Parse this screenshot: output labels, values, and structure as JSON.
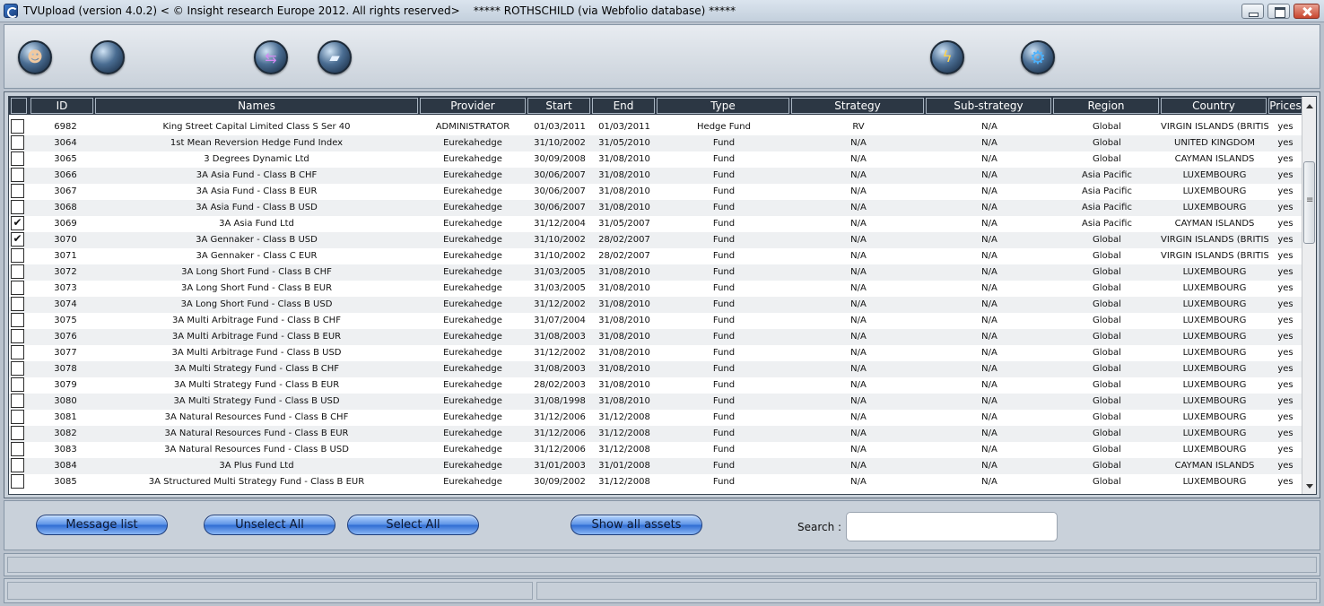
{
  "window": {
    "title": "TVUpload (version 4.0.2) < © Insight research Europe 2012. All rights reserved>    ***** ROTHSCHILD (via Webfolio database) *****"
  },
  "toolbar": {
    "icons": [
      "user-icon",
      "grid-icon",
      "sync-icon",
      "book-icon",
      "bolt-icon",
      "gear-icon"
    ]
  },
  "table": {
    "headers": {
      "id": "ID",
      "names": "Names",
      "provider": "Provider",
      "start": "Start",
      "end": "End",
      "type": "Type",
      "strategy": "Strategy",
      "substrategy": "Sub-strategy",
      "region": "Region",
      "country": "Country",
      "prices": "Prices"
    },
    "rows": [
      {
        "checked": false,
        "id": "6982",
        "name": "King Street Capital Limited Class S  Ser 40",
        "provider": "ADMINISTRATOR",
        "start": "01/03/2011",
        "end": "01/03/2011",
        "type": "Hedge Fund",
        "strategy": "RV",
        "substrategy": "N/A",
        "region": "Global",
        "country": "VIRGIN ISLANDS (BRITISH)",
        "prices": "yes"
      },
      {
        "checked": false,
        "id": "3064",
        "name": "1st Mean Reversion Hedge Fund Index",
        "provider": "Eurekahedge",
        "start": "31/10/2002",
        "end": "31/05/2010",
        "type": "Fund",
        "strategy": "N/A",
        "substrategy": "N/A",
        "region": "Global",
        "country": "UNITED KINGDOM",
        "prices": "yes"
      },
      {
        "checked": false,
        "id": "3065",
        "name": "3 Degrees Dynamic Ltd",
        "provider": "Eurekahedge",
        "start": "30/09/2008",
        "end": "31/08/2010",
        "type": "Fund",
        "strategy": "N/A",
        "substrategy": "N/A",
        "region": "Global",
        "country": "CAYMAN ISLANDS",
        "prices": "yes"
      },
      {
        "checked": false,
        "id": "3066",
        "name": "3A Asia Fund - Class B CHF",
        "provider": "Eurekahedge",
        "start": "30/06/2007",
        "end": "31/08/2010",
        "type": "Fund",
        "strategy": "N/A",
        "substrategy": "N/A",
        "region": "Asia Pacific",
        "country": "LUXEMBOURG",
        "prices": "yes"
      },
      {
        "checked": false,
        "id": "3067",
        "name": "3A Asia Fund - Class B EUR",
        "provider": "Eurekahedge",
        "start": "30/06/2007",
        "end": "31/08/2010",
        "type": "Fund",
        "strategy": "N/A",
        "substrategy": "N/A",
        "region": "Asia Pacific",
        "country": "LUXEMBOURG",
        "prices": "yes"
      },
      {
        "checked": false,
        "id": "3068",
        "name": "3A Asia Fund - Class B USD",
        "provider": "Eurekahedge",
        "start": "30/06/2007",
        "end": "31/08/2010",
        "type": "Fund",
        "strategy": "N/A",
        "substrategy": "N/A",
        "region": "Asia Pacific",
        "country": "LUXEMBOURG",
        "prices": "yes"
      },
      {
        "checked": true,
        "id": "3069",
        "name": "3A Asia Fund Ltd",
        "provider": "Eurekahedge",
        "start": "31/12/2004",
        "end": "31/05/2007",
        "type": "Fund",
        "strategy": "N/A",
        "substrategy": "N/A",
        "region": "Asia Pacific",
        "country": "CAYMAN ISLANDS",
        "prices": "yes"
      },
      {
        "checked": true,
        "id": "3070",
        "name": "3A Gennaker - Class B USD",
        "provider": "Eurekahedge",
        "start": "31/10/2002",
        "end": "28/02/2007",
        "type": "Fund",
        "strategy": "N/A",
        "substrategy": "N/A",
        "region": "Global",
        "country": "VIRGIN ISLANDS (BRITISH)",
        "prices": "yes"
      },
      {
        "checked": false,
        "id": "3071",
        "name": "3A Gennaker - Class C EUR",
        "provider": "Eurekahedge",
        "start": "31/10/2002",
        "end": "28/02/2007",
        "type": "Fund",
        "strategy": "N/A",
        "substrategy": "N/A",
        "region": "Global",
        "country": "VIRGIN ISLANDS (BRITISH)",
        "prices": "yes"
      },
      {
        "checked": false,
        "id": "3072",
        "name": "3A Long Short Fund - Class B CHF",
        "provider": "Eurekahedge",
        "start": "31/03/2005",
        "end": "31/08/2010",
        "type": "Fund",
        "strategy": "N/A",
        "substrategy": "N/A",
        "region": "Global",
        "country": "LUXEMBOURG",
        "prices": "yes"
      },
      {
        "checked": false,
        "id": "3073",
        "name": "3A Long Short Fund - Class B EUR",
        "provider": "Eurekahedge",
        "start": "31/03/2005",
        "end": "31/08/2010",
        "type": "Fund",
        "strategy": "N/A",
        "substrategy": "N/A",
        "region": "Global",
        "country": "LUXEMBOURG",
        "prices": "yes"
      },
      {
        "checked": false,
        "id": "3074",
        "name": "3A Long Short Fund - Class B USD",
        "provider": "Eurekahedge",
        "start": "31/12/2002",
        "end": "31/08/2010",
        "type": "Fund",
        "strategy": "N/A",
        "substrategy": "N/A",
        "region": "Global",
        "country": "LUXEMBOURG",
        "prices": "yes"
      },
      {
        "checked": false,
        "id": "3075",
        "name": "3A Multi Arbitrage Fund - Class B CHF",
        "provider": "Eurekahedge",
        "start": "31/07/2004",
        "end": "31/08/2010",
        "type": "Fund",
        "strategy": "N/A",
        "substrategy": "N/A",
        "region": "Global",
        "country": "LUXEMBOURG",
        "prices": "yes"
      },
      {
        "checked": false,
        "id": "3076",
        "name": "3A Multi Arbitrage Fund - Class B EUR",
        "provider": "Eurekahedge",
        "start": "31/08/2003",
        "end": "31/08/2010",
        "type": "Fund",
        "strategy": "N/A",
        "substrategy": "N/A",
        "region": "Global",
        "country": "LUXEMBOURG",
        "prices": "yes"
      },
      {
        "checked": false,
        "id": "3077",
        "name": "3A Multi Arbitrage Fund - Class B USD",
        "provider": "Eurekahedge",
        "start": "31/12/2002",
        "end": "31/08/2010",
        "type": "Fund",
        "strategy": "N/A",
        "substrategy": "N/A",
        "region": "Global",
        "country": "LUXEMBOURG",
        "prices": "yes"
      },
      {
        "checked": false,
        "id": "3078",
        "name": "3A Multi Strategy Fund - Class B CHF",
        "provider": "Eurekahedge",
        "start": "31/08/2003",
        "end": "31/08/2010",
        "type": "Fund",
        "strategy": "N/A",
        "substrategy": "N/A",
        "region": "Global",
        "country": "LUXEMBOURG",
        "prices": "yes"
      },
      {
        "checked": false,
        "id": "3079",
        "name": "3A Multi Strategy Fund - Class B EUR",
        "provider": "Eurekahedge",
        "start": "28/02/2003",
        "end": "31/08/2010",
        "type": "Fund",
        "strategy": "N/A",
        "substrategy": "N/A",
        "region": "Global",
        "country": "LUXEMBOURG",
        "prices": "yes"
      },
      {
        "checked": false,
        "id": "3080",
        "name": "3A Multi Strategy Fund - Class B USD",
        "provider": "Eurekahedge",
        "start": "31/08/1998",
        "end": "31/08/2010",
        "type": "Fund",
        "strategy": "N/A",
        "substrategy": "N/A",
        "region": "Global",
        "country": "LUXEMBOURG",
        "prices": "yes"
      },
      {
        "checked": false,
        "id": "3081",
        "name": "3A Natural Resources Fund - Class B CHF",
        "provider": "Eurekahedge",
        "start": "31/12/2006",
        "end": "31/12/2008",
        "type": "Fund",
        "strategy": "N/A",
        "substrategy": "N/A",
        "region": "Global",
        "country": "LUXEMBOURG",
        "prices": "yes"
      },
      {
        "checked": false,
        "id": "3082",
        "name": "3A Natural Resources Fund - Class B EUR",
        "provider": "Eurekahedge",
        "start": "31/12/2006",
        "end": "31/12/2008",
        "type": "Fund",
        "strategy": "N/A",
        "substrategy": "N/A",
        "region": "Global",
        "country": "LUXEMBOURG",
        "prices": "yes"
      },
      {
        "checked": false,
        "id": "3083",
        "name": "3A Natural Resources Fund - Class B USD",
        "provider": "Eurekahedge",
        "start": "31/12/2006",
        "end": "31/12/2008",
        "type": "Fund",
        "strategy": "N/A",
        "substrategy": "N/A",
        "region": "Global",
        "country": "LUXEMBOURG",
        "prices": "yes"
      },
      {
        "checked": false,
        "id": "3084",
        "name": "3A Plus Fund Ltd",
        "provider": "Eurekahedge",
        "start": "31/01/2003",
        "end": "31/01/2008",
        "type": "Fund",
        "strategy": "N/A",
        "substrategy": "N/A",
        "region": "Global",
        "country": "CAYMAN ISLANDS",
        "prices": "yes"
      },
      {
        "checked": false,
        "id": "3085",
        "name": "3A Structured Multi Strategy Fund - Class B EUR",
        "provider": "Eurekahedge",
        "start": "30/09/2002",
        "end": "31/12/2008",
        "type": "Fund",
        "strategy": "N/A",
        "substrategy": "N/A",
        "region": "Global",
        "country": "LUXEMBOURG",
        "prices": "yes"
      }
    ]
  },
  "controls": {
    "message_list": "Message list",
    "unselect_all": "Unselect All",
    "select_all": "Select All",
    "show_all_assets": "Show all assets",
    "search_label": "Search :",
    "search_value": "",
    "checkmark": "✔"
  },
  "colors": {
    "background": "#b9c2cd",
    "header": "#2e3947",
    "button": "#2f6cd3"
  }
}
